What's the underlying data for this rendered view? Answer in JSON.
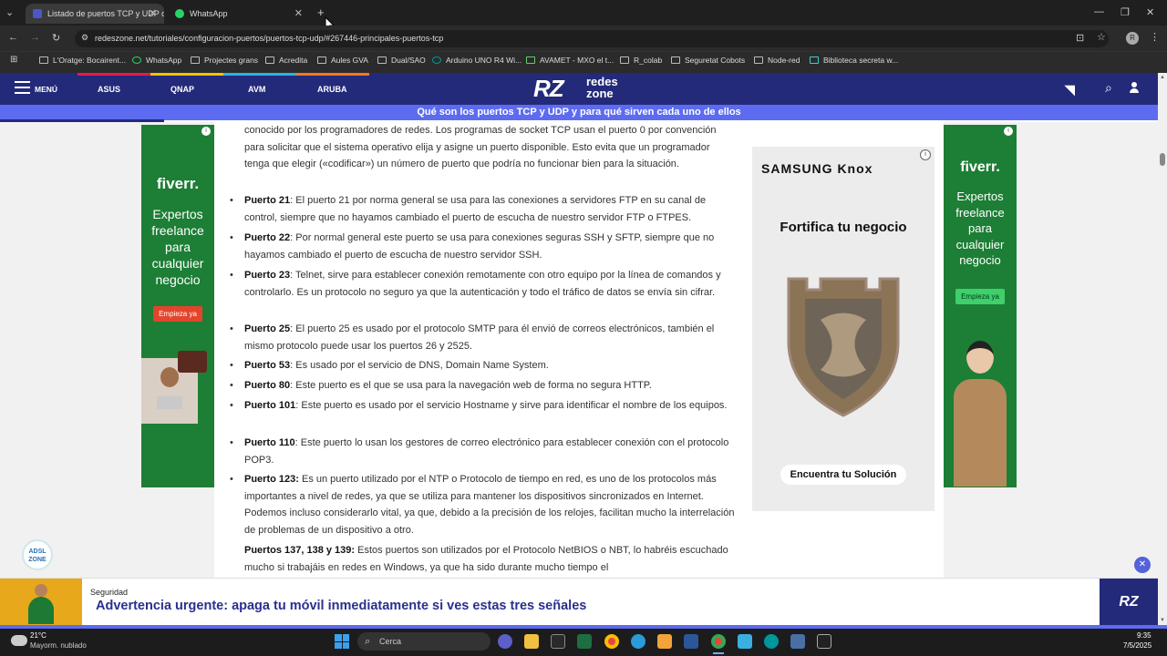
{
  "tabs": [
    {
      "title": "Listado de puertos TCP y UDP d"
    },
    {
      "title": "WhatsApp"
    }
  ],
  "url": "redeszone.net/tutoriales/configuracion-puertos/puertos-tcp-udp/#267446-principales-puertos-tcp",
  "bookmarks": [
    "L'Oratge: Bocairent...",
    "WhatsApp",
    "Projectes grans",
    "Acredita",
    "Aules GVA",
    "Dual/SAO",
    "Arduino UNO R4 Wi...",
    "AVAMET - MXO el t...",
    "R_colab",
    "Seguretat Cobots",
    "Node-red",
    "Biblioteca secreta w..."
  ],
  "site": {
    "menu": "MENÚ",
    "nav": [
      "ASUS",
      "QNAP",
      "AVM",
      "ARUBA"
    ],
    "logo_rz": "RZ",
    "logo_text1": "redes",
    "logo_text2": "zone",
    "subtitle": "Qué son los puertos TCP y UDP y para qué sirven cada uno de ellos"
  },
  "article": {
    "intro": "conocido por los programadores de redes. Los programas de socket TCP usan el puerto 0 por convención para solicitar que el sistema operativo elija y asigne un puerto disponible. Esto evita que un programador tenga que elegir («codificar») un número de puerto que podría no funcionar bien para la situación.",
    "items": [
      {
        "port": "Puerto 21",
        "text": ": El puerto 21 por norma general se usa para las conexiones a servidores FTP en su canal de control, siempre que no hayamos cambiado el puerto de escucha de nuestro servidor FTP o FTPES."
      },
      {
        "port": "Puerto 22",
        "text": ": Por normal general este puerto se usa para conexiones seguras SSH y SFTP, siempre que no hayamos cambiado el puerto de escucha de nuestro servidor SSH."
      },
      {
        "port": "Puerto 23",
        "text": ": Telnet, sirve para establecer conexión remotamente con otro equipo por la línea de comandos y controlarlo. Es un protocolo no seguro ya que la autenticación y todo el tráfico de datos se envía sin cifrar."
      },
      {
        "port": "Puerto 25",
        "text": ":  El puerto 25 es usado por el protocolo SMTP para él envió de correos electrónicos, también el mismo protocolo puede usar los puertos 26 y 2525."
      },
      {
        "port": "Puerto 53",
        "text": ": Es usado por el servicio de DNS, Domain Name System."
      },
      {
        "port": "Puerto 80",
        "text": ": Este puerto es el que se usa para la navegación web de forma no segura HTTP."
      },
      {
        "port": "Puerto 101",
        "text": ": Este puerto es usado por el servicio Hostname y sirve para identificar el nombre de los equipos."
      },
      {
        "port": "Puerto 110",
        "text": ": Este puerto lo usan los gestores de correo electrónico para establecer conexión con el protocolo POP3."
      },
      {
        "port": "Puerto 123:",
        "text": " Es un puerto utilizado por el NTP o Protocolo de tiempo en red, es uno de los protocolos más importantes a nivel de redes, ya que se utiliza para mantener los dispositivos sincronizados en Internet. Podemos incluso considerarlo vital, ya que, debido a la precisión de los relojes, facilitan mucho la interrelación de problemas de un dispositivo a otro."
      },
      {
        "port": "Puertos 137, 138 y 139:",
        "text": " Estos puertos son utilizados por el Protocolo NetBIOS o NBT, lo habréis escuchado mucho si trabajáis en redes en Windows, ya que ha sido durante mucho tiempo el"
      }
    ]
  },
  "ads": {
    "left": {
      "brand": "fiverr.",
      "text": "Expertos freelance para cualquier negocio",
      "cta": "Empieza ya"
    },
    "right": {
      "brand": "fiverr.",
      "text": "Expertos freelance para cualquier negocio",
      "cta": "Empieza ya"
    },
    "samsung": {
      "brand": "SAMSUNG Knox",
      "headline": "Fortifica tu negocio",
      "cta": "Encuentra tu Solución"
    }
  },
  "banner": {
    "category": "Seguridad",
    "headline": "Advertencia urgente: apaga tu móvil inmediatamente si ves estas tres señales",
    "logo": "RZ"
  },
  "badge": "ADSL ZONE",
  "taskbar": {
    "temp": "21°C",
    "weather": "Mayorm. nublado",
    "search": "Cerca",
    "time": "9:35",
    "date": "7/5/2025"
  }
}
